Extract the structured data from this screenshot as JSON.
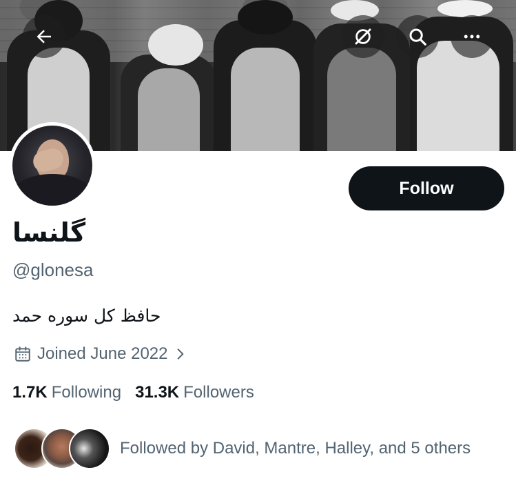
{
  "header": {
    "back_icon": "arrow-left-icon",
    "grok_icon": "grok-icon",
    "search_icon": "search-icon",
    "more_icon": "more-horizontal-icon"
  },
  "profile": {
    "display_name": "گلنسا",
    "handle": "@glonesa",
    "bio": "حافظ کل سوره حمد",
    "joined": "Joined June 2022",
    "follow_label": "Follow",
    "following_count": "1.7K",
    "following_label": "Following",
    "followers_count": "31.3K",
    "followers_label": "Followers",
    "followed_by": "Followed by David, Mantre, Halley, and 5 others"
  },
  "colors": {
    "text_primary": "#0f1419",
    "text_secondary": "#536471",
    "button_bg": "#0f1419",
    "button_text": "#ffffff"
  }
}
